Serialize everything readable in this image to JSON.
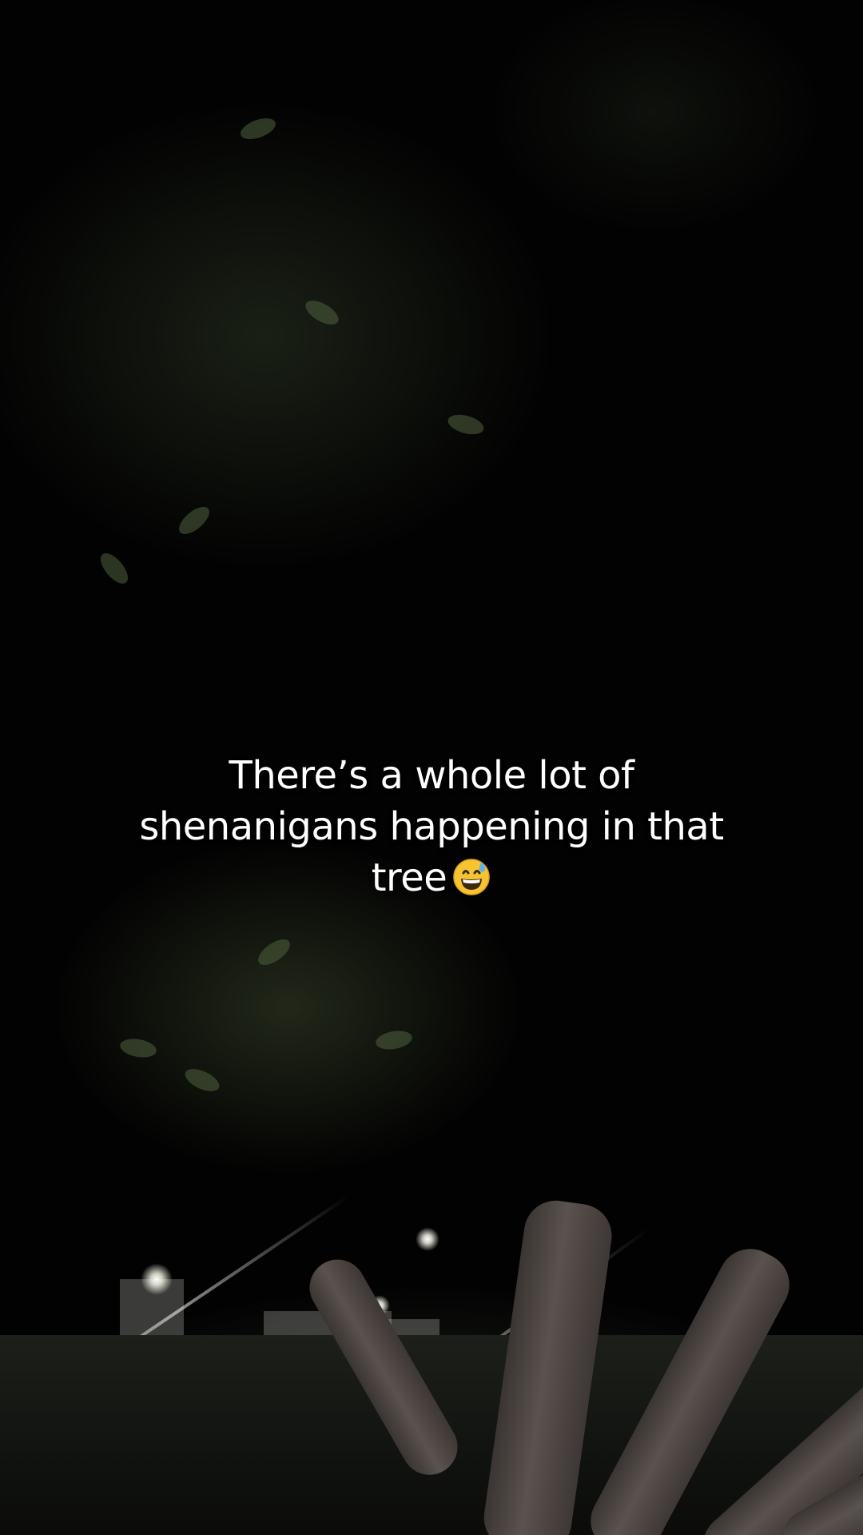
{
  "caption": {
    "text": "There’s a whole lot of shenanigans happening in that tree",
    "emoji_icon": "grinning-face-with-sweat-icon"
  },
  "colors": {
    "caption_text": "#ffffff",
    "background": "#020202"
  }
}
